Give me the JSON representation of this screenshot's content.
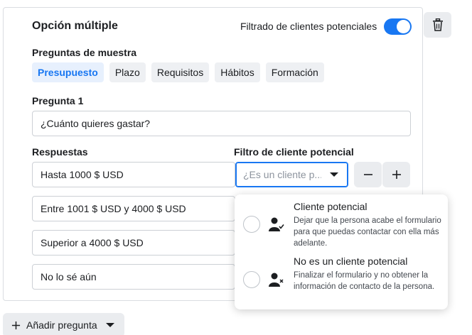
{
  "card": {
    "title": "Opción múltiple",
    "filter_label": "Filtrado de clientes potenciales",
    "filter_enabled": true
  },
  "samples": {
    "label": "Preguntas de muestra",
    "chips": [
      {
        "label": "Presupuesto",
        "active": true
      },
      {
        "label": "Plazo",
        "active": false
      },
      {
        "label": "Requisitos",
        "active": false
      },
      {
        "label": "Hábitos",
        "active": false
      },
      {
        "label": "Formación",
        "active": false
      }
    ]
  },
  "question": {
    "label": "Pregunta 1",
    "value": "¿Cuánto quieres gastar?"
  },
  "answers": {
    "label": "Respuestas",
    "filter_column_label": "Filtro de cliente potencial",
    "items": [
      "Hasta 1000 $ USD",
      "Entre 1001 $ USD y 4000 $ USD",
      "Superior a 4000 $ USD",
      "No lo sé aún"
    ],
    "select_placeholder": "¿Es un cliente p..."
  },
  "dropdown": {
    "options": [
      {
        "title": "Cliente potencial",
        "description": "Dejar que la persona acabe el formulario para que puedas contactar con ella más adelante.",
        "icon": "person-check-icon"
      },
      {
        "title": "No es un cliente potencial",
        "description": "Finalizar el formulario y no obtener la información de contacto de la persona.",
        "icon": "person-x-icon"
      }
    ]
  },
  "footer": {
    "add_question_label": "Añadir pregunta"
  },
  "colors": {
    "accent": "#1877f2",
    "button_bg": "#eaecef"
  }
}
